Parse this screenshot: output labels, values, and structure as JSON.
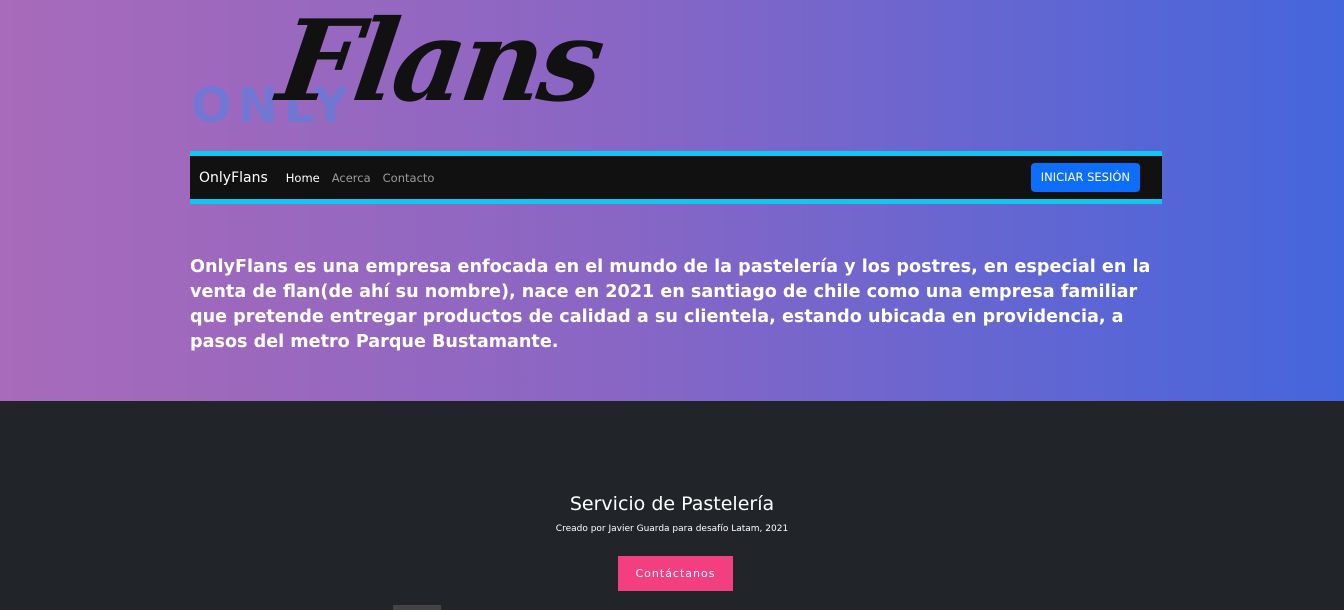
{
  "logo": {
    "only": "ONLY",
    "flans": "Flans"
  },
  "navbar": {
    "brand": "OnlyFlans",
    "links": [
      "Home",
      "Acerca",
      "Contacto"
    ],
    "login_label": "INICIAR SESIÓN"
  },
  "intro": {
    "text": "OnlyFlans es una empresa enfocada en el mundo de la pastelería y los postres, en especial en la venta de flan(de ahí su nombre), nace en 2021 en santiago de chile como una empresa familiar que pretende entregar productos de calidad a su clientela, estando ubicada en providencia, a pasos del metro Parque Bustamante."
  },
  "footer": {
    "title": "Servicio de Pastelería",
    "subtitle": "Creado por Javier Guarda para desafío Latam, 2021",
    "contact_label": "Contáctanos"
  },
  "colors": {
    "navbar_border": "#13c6ef",
    "login_button": "#0d6efd",
    "contact_button": "#f33f7f",
    "footer_bg": "#212529"
  }
}
